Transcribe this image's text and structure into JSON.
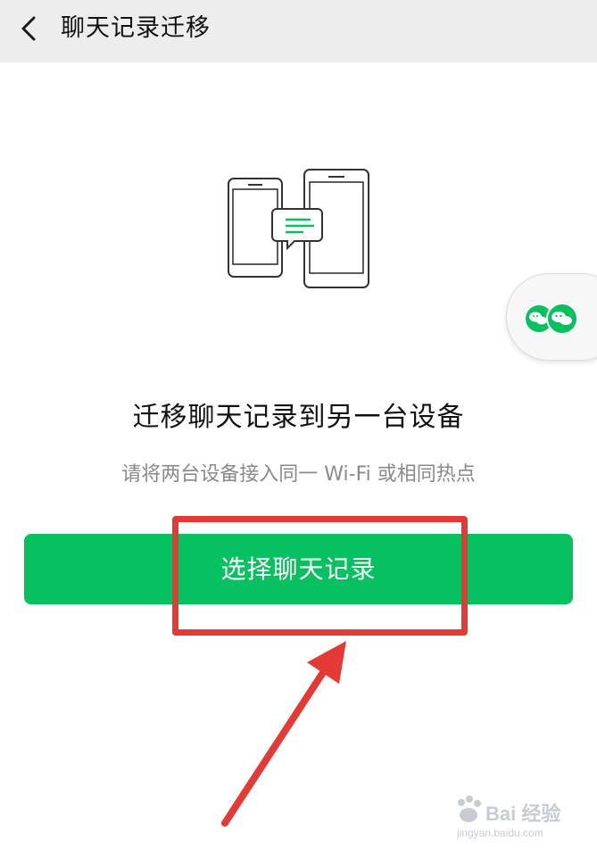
{
  "header": {
    "back_icon": "chevron-left-icon",
    "title": "聊天记录迁移"
  },
  "hero": {
    "icon": "phone-to-phone-transfer-illustration"
  },
  "floating": {
    "icon": "wechat-dual-icon"
  },
  "content": {
    "title": "迁移聊天记录到另一台设备",
    "subtitle": "请将两台设备接入同一 Wi-Fi 或相同热点"
  },
  "actions": {
    "primary_label": "选择聊天记录"
  },
  "annotation": {
    "highlight_color": "#e53935",
    "arrow_color": "#e53935"
  },
  "watermark": {
    "brand": "Bai 经验",
    "url": "jingyan.baidu.com"
  },
  "colors": {
    "accent": "#07c160",
    "header_bg": "#ededed"
  }
}
